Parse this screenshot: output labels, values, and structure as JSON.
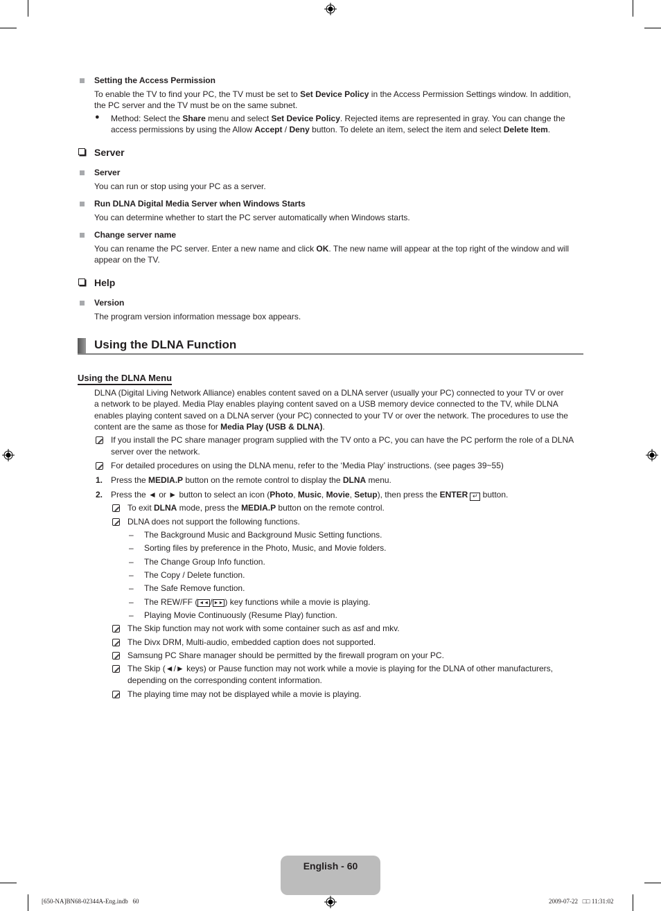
{
  "access_permission": {
    "title": "Setting the Access Permission",
    "line1_a": "To enable the TV to find your PC, the TV must be set to ",
    "line1_b": "Set Device Policy",
    "line1_c": " in the Access Permission Settings window. In addition,",
    "line2": "the PC server and the TV must be on the same subnet.",
    "method_a": "Method: Select the ",
    "method_b": "Share",
    "method_c": " menu and select ",
    "method_d": "Set Device Policy",
    "method_e": ". Rejected items are represented in gray. You can change the",
    "method2_a": "access permissions by using the Allow ",
    "method2_b": "Accept",
    "method2_c": " / ",
    "method2_d": "Deny",
    "method2_e": " button. To delete an item, select the item and select ",
    "method2_f": "Delete Item",
    "method2_g": "."
  },
  "server_section": {
    "title": "Server",
    "items": [
      {
        "title": "Server",
        "text": "You can run or stop using your PC as a server."
      },
      {
        "title": "Run DLNA Digital Media Server when Windows Starts",
        "text": "You can determine whether to start the PC server automatically when Windows starts."
      },
      {
        "title": "Change server name",
        "text_a": "You can rename the PC server. Enter a new name and click ",
        "text_b": "OK",
        "text_c": ". The new name will appear at the top right of the window and will",
        "text2": "appear on the TV."
      }
    ]
  },
  "help_section": {
    "title": "Help",
    "item_title": "Version",
    "item_text": "The program version information message box appears."
  },
  "dlna": {
    "heading": "Using the DLNA Function",
    "subheading": "Using the DLNA Menu",
    "intro_lines": [
      "DLNA (Digital Living Network Alliance) enables content saved on a DLNA server (usually your PC) connected to your TV or over",
      "a network to be played. Media Play enables playing content saved on a USB memory device connected to the TV, while DLNA",
      "enables playing content saved on a DLNA server (your PC) connected to your TV or over the network. The procedures to use the"
    ],
    "intro_last_a": "content are the same as those for ",
    "intro_last_b": "Media Play (USB & DLNA)",
    "intro_last_c": ".",
    "note1_line1": "If you install the PC share manager program supplied with the TV onto a PC, you can have the PC perform the role of a DLNA",
    "note1_line2": "server over the network.",
    "note2": "For detailed procedures on using the DLNA menu, refer to the ‘Media Play’ instructions. (see pages 39~55)",
    "step1": {
      "num": "1.",
      "a": "Press the ",
      "b": "MEDIA.P",
      "c": " button on the remote control to display the ",
      "d": "DLNA",
      "e": " menu."
    },
    "step2": {
      "num": "2.",
      "a": "Press the ◄ or ► button to select an icon (",
      "b": "Photo",
      "c": ", ",
      "d": "Music",
      "e": ", ",
      "f": "Movie",
      "g": ", ",
      "h": "Setup",
      "i": "), then press the ",
      "j": "ENTER",
      "k": " button."
    },
    "sub_note1": {
      "a": "To exit ",
      "b": "DLNA",
      "c": " mode, press the ",
      "d": "MEDIA.P",
      "e": " button on the remote control."
    },
    "sub_note2": "DLNA does not support the following functions.",
    "unsupported": [
      "The Background Music and Background Music Setting functions.",
      "Sorting files by preference in the Photo, Music, and Movie folders.",
      "The Change Group Info function.",
      "The Copy / Delete function.",
      "The Safe Remove function.",
      "Playing Movie Continuously (Resume Play) function."
    ],
    "rewff_a": "The REW/FF (",
    "rewff_rew": "◄◄",
    "rewff_sep": "/",
    "rewff_ff": "►►",
    "rewff_b": ") key functions while a movie is playing.",
    "notes": [
      "The Skip function may not work with some container such as asf and mkv.",
      "The Divx DRM, Multi-audio, embedded caption does not supported.",
      "Samsung PC Share manager should be permitted by the firewall program on your PC."
    ],
    "skip_line1": "The Skip (◄/► keys) or Pause function may not work while a movie is playing for the DLNA of other manufacturers,",
    "skip_line2": "depending on the corresponding content information.",
    "last_note": "The playing time may not be displayed while a movie is playing."
  },
  "footer": {
    "page_label": "English - 60",
    "file_info": "[650-NA]BN68-02344A-Eng.indb   60",
    "timestamp": "2009-07-22   □□ 11:31:02"
  }
}
